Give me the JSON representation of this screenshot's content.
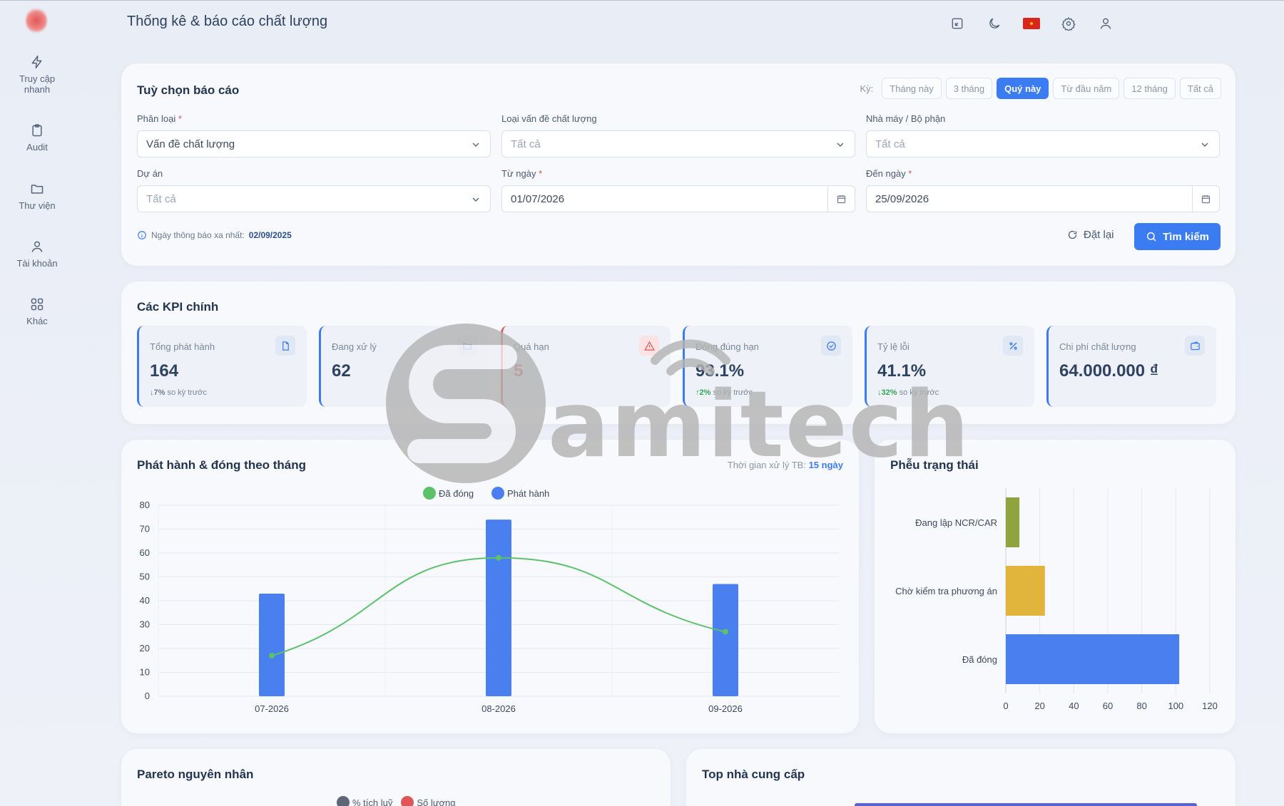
{
  "header": {
    "title": "Thống kê & báo cáo chất lượng"
  },
  "sidebar": {
    "items": [
      {
        "label": "Truy cập nhanh",
        "icon": "lightning-icon"
      },
      {
        "label": "Audit",
        "icon": "clipboard-icon"
      },
      {
        "label": "Thư viện",
        "icon": "folder-icon"
      },
      {
        "label": "Tài khoản",
        "icon": "user-icon"
      },
      {
        "label": "Khác",
        "icon": "grid-icon"
      }
    ]
  },
  "options": {
    "title": "Tuỳ chọn báo cáo",
    "period_label": "Kỳ:",
    "periods": [
      "Tháng này",
      "3 tháng",
      "Quý này",
      "Từ đầu năm",
      "12 tháng",
      "Tất cả"
    ],
    "active_period": "Quý này",
    "fields": {
      "category": {
        "label": "Phân loại",
        "required": "*",
        "value": "Vấn đề chất lượng"
      },
      "issue_type": {
        "label": "Loại vấn đề chất lượng",
        "placeholder": "Tất cả"
      },
      "plant": {
        "label": "Nhà máy / Bộ phận",
        "placeholder": "Tất cả"
      },
      "project": {
        "label": "Dự án",
        "placeholder": "Tất cả"
      },
      "from_date": {
        "label": "Từ ngày",
        "required": "*",
        "value": "01/07/2026"
      },
      "to_date": {
        "label": "Đến ngày",
        "required": "*",
        "value": "25/09/2026"
      }
    },
    "note_label": "Ngày thông báo xa nhất:",
    "note_value": "02/09/2025",
    "reset_label": "Đặt lại",
    "search_label": "Tìm kiếm"
  },
  "kpis": {
    "title": "Các KPI chính",
    "items": [
      {
        "label": "Tổng phát hành",
        "value": "164",
        "trend_arrow": "↓",
        "trend_pct": "7%",
        "trend_text": "so kỳ trước"
      },
      {
        "label": "Đang xử lý",
        "value": "62"
      },
      {
        "label": "Quá hạn",
        "value": "5"
      },
      {
        "label": "Đóng đúng hạn",
        "value": "93.1%",
        "trend_arrow": "↑",
        "trend_pct": "2%",
        "trend_text": "so kỳ trước"
      },
      {
        "label": "Tỷ lệ lỗi",
        "value": "41.1%",
        "trend_arrow": "↓",
        "trend_pct": "32%",
        "trend_text": "so kỳ trước"
      },
      {
        "label": "Chi phí chất lượng",
        "value": "64.000.000 ₫"
      }
    ]
  },
  "monthly": {
    "title": "Phát hành & đóng theo tháng",
    "avg_label": "Thời gian xử lý TB:",
    "avg_value": "15 ngày"
  },
  "funnel": {
    "title": "Phễu trạng thái"
  },
  "pareto": {
    "title": "Pareto nguyên nhân",
    "legend": [
      "% tích luỹ",
      "Số lượng"
    ]
  },
  "suppliers": {
    "title": "Top nhà cung cấp"
  },
  "watermark": {
    "text": "amitech"
  },
  "colors": {
    "accent": "#3c7cf2",
    "closed": "#5cc26a",
    "danger": "#e05555",
    "funnel": [
      "#8fa43e",
      "#e1b53c",
      "#4a7ff0"
    ]
  },
  "chart_data": [
    {
      "type": "bar",
      "categories": [
        "07-2026",
        "08-2026",
        "09-2026"
      ],
      "series": [
        {
          "name": "Phát hành",
          "type": "bar",
          "values": [
            43,
            74,
            47
          ]
        },
        {
          "name": "Đã đóng",
          "type": "line",
          "values": [
            17,
            58,
            27
          ]
        }
      ],
      "ylim": [
        0,
        80
      ],
      "yticks": [
        0,
        10,
        20,
        30,
        40,
        50,
        60,
        70,
        80
      ],
      "legend": "top-center",
      "grid": true
    },
    {
      "type": "bar",
      "orientation": "horizontal",
      "categories": [
        "Đang lập NCR/CAR",
        "Chờ kiểm tra phương án",
        "Đã đóng"
      ],
      "values": [
        8,
        23,
        102
      ],
      "xlim": [
        0,
        120
      ],
      "xticks": [
        0,
        20,
        40,
        60,
        80,
        100,
        120
      ],
      "grid": true
    }
  ]
}
